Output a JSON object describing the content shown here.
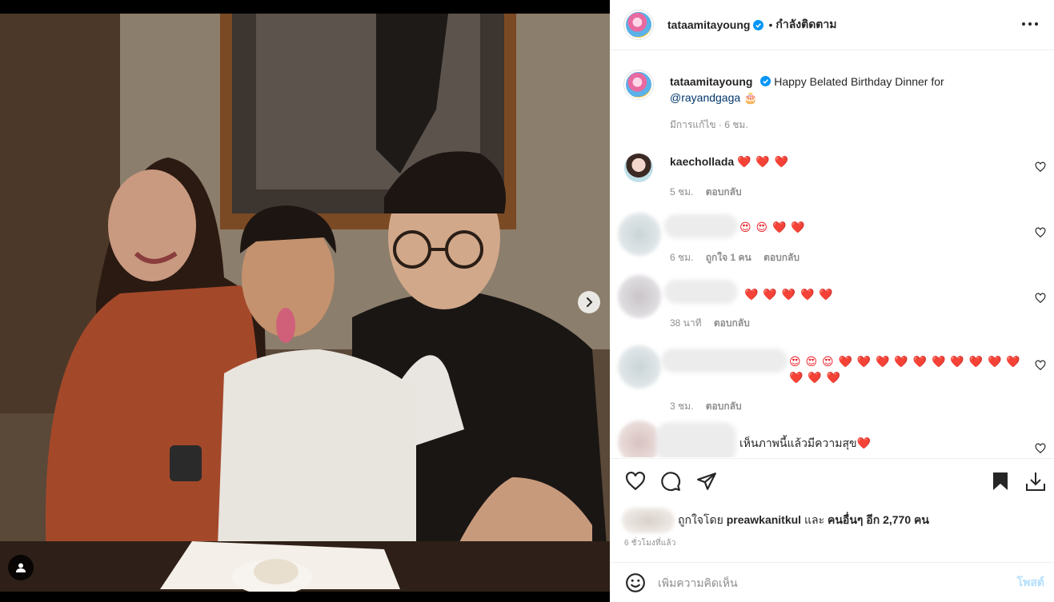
{
  "media": {
    "next_icon": "chevron-right-icon",
    "tag_icon": "person-tag-icon"
  },
  "header": {
    "username": "tataamitayoung",
    "separator": "•",
    "follow_label": "กำลังติดตาม",
    "verified_icon": "verified-badge-icon",
    "more_icon": "more-horizontal-icon"
  },
  "caption": {
    "username": "tataamitayoung",
    "text": "Happy Belated Birthday Dinner for",
    "mention": "@rayandgaga",
    "emoji": "🎂",
    "meta": "มีการแก้ไข · 6 ชม."
  },
  "comments": [
    {
      "username": "kaechollada",
      "text": "❤️ ❤️ ❤️",
      "time": "5 ชม.",
      "likes": "",
      "reply": "ตอบกลับ"
    },
    {
      "username": "",
      "text": "😍 😍 ❤️ ❤️",
      "time": "6 ชม.",
      "likes": "ถูกใจ 1 คน",
      "reply": "ตอบกลับ"
    },
    {
      "username": "",
      "text": "❤️ ❤️ ❤️ ❤️ ❤️",
      "time": "38 นาที",
      "likes": "",
      "reply": "ตอบกลับ"
    },
    {
      "username": "",
      "text": "😍 😍 😍 ❤️ ❤️ ❤️ ❤️ ❤️ ❤️ ❤️ ❤️ ❤️ ❤️ ❤️ ❤️ ❤️",
      "time": "3 ชม.",
      "likes": "",
      "reply": "ตอบกลับ"
    },
    {
      "username": "",
      "text": "เห็นภาพนี้แล้วมีความสุข❤️",
      "time": "",
      "likes": "",
      "reply": ""
    }
  ],
  "actions": {
    "like_icon": "heart-icon",
    "comment_icon": "comment-icon",
    "share_icon": "send-icon",
    "save_icon": "bookmark-icon",
    "download_icon": "download-icon"
  },
  "likes": {
    "prefix": "ถูกใจโดย",
    "user": "preawkanitkul",
    "conj": "และ",
    "others": "คนอื่นๆ อีก 2,770 คน"
  },
  "timestamp": "6 ชั่วโมงที่แล้ว",
  "add_comment": {
    "emoji_icon": "smiley-icon",
    "placeholder": "เพิ่มความคิดเห็น",
    "post_label": "โพสต์"
  },
  "colors": {
    "accent_link": "#00376b",
    "verified": "#0095f6",
    "heart": "#ed1c24",
    "post_disabled": "#b2dffc",
    "meta": "#8e8e8e"
  }
}
